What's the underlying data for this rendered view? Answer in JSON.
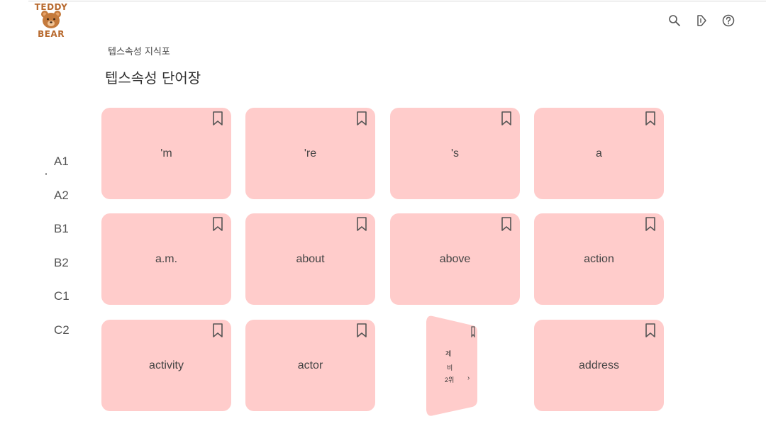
{
  "logo": {
    "top_text": "TEDDY",
    "bottom_text": "BEAR",
    "brand_color": "#b86a2f",
    "bear_color": "#c47a3c"
  },
  "header": {
    "icons": [
      "search-icon",
      "sound-icon",
      "help-icon"
    ]
  },
  "breadcrumb": "텝스속성 지식포",
  "page_title": "텝스속성 단어장",
  "levels": [
    "A1",
    "A2",
    "B1",
    "B2",
    "C1",
    "C2"
  ],
  "selected_level": "A1",
  "cards": [
    {
      "word": "'m"
    },
    {
      "word": "'re"
    },
    {
      "word": "'s"
    },
    {
      "word": "a"
    },
    {
      "word": "a.m."
    },
    {
      "word": "about"
    },
    {
      "word": "above"
    },
    {
      "word": "action"
    },
    {
      "word": "activity"
    },
    {
      "word": "actor"
    },
    {
      "word": ""
    },
    {
      "word": "address"
    }
  ],
  "flip_card": {
    "lines": [
      "제",
      "비",
      "2위"
    ],
    "arrow": "›"
  },
  "colors": {
    "card_bg": "#ffcccb",
    "text": "#444444"
  }
}
